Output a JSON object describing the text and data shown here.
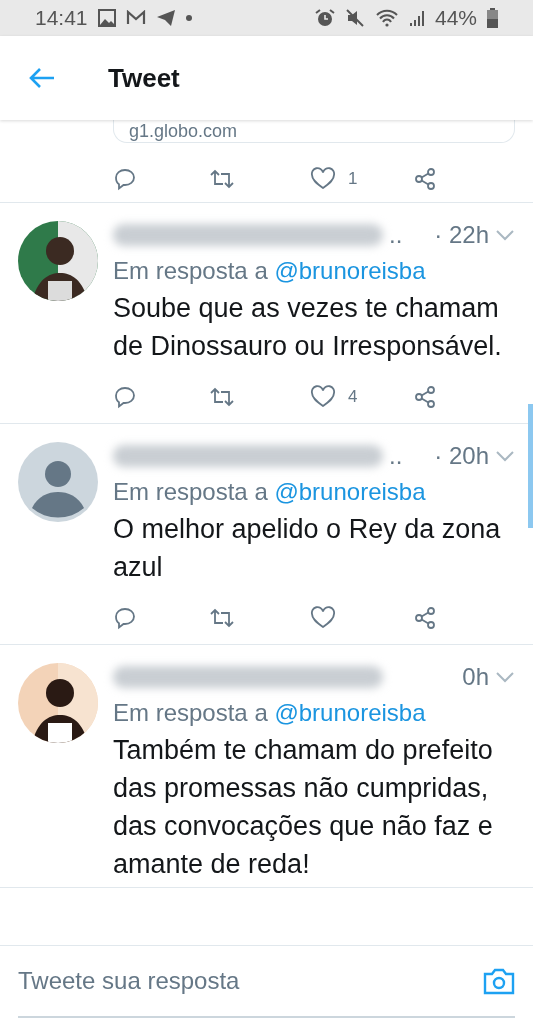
{
  "status_bar": {
    "time": "14:41",
    "battery": "44%"
  },
  "header": {
    "title": "Tweet"
  },
  "link_card": {
    "domain": "g1.globo.com"
  },
  "top_actions": {
    "likes": "1"
  },
  "tweets": [
    {
      "name_end": "..",
      "time": "· 22h",
      "reply_label": "Em resposta a",
      "reply_to": "@brunoreisba",
      "text": "Soube que as vezes te chamam de Dinossauro ou Irresponsável.",
      "actions_shown": true,
      "likes": "4"
    },
    {
      "avatar": {
        "kind": "default"
      },
      "name_end": "..",
      "time": "· 20h",
      "reply_label": "Em resposta a",
      "reply_to": "@brunoreisba",
      "text": "O melhor apelido o Rey da zona azul",
      "actions_shown": true
    },
    {
      "time": "0h",
      "reply_label": "Em resposta a",
      "reply_to": "@brunoreisba",
      "text": "Também te chamam do prefeito das promessas não cumpridas, das convocações que não faz e amante de reda!",
      "actions_shown": false
    }
  ],
  "reply_bar": {
    "placeholder": "Tweete sua resposta"
  }
}
